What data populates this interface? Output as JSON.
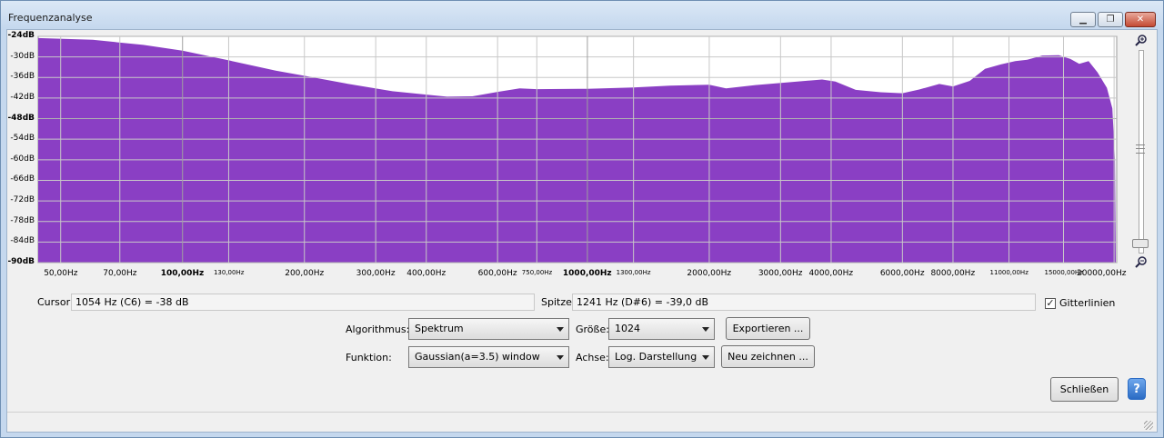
{
  "window": {
    "title": "Frequenzanalyse",
    "controls": {
      "minimize": "▁",
      "maximize": "❐",
      "close": "✕"
    }
  },
  "spectrum": {
    "fill_color": "#8a3fc4",
    "grid_color": "#c8c8c8",
    "db_labels": [
      {
        "text": "-24dB",
        "db": -24,
        "bold": true
      },
      {
        "text": "-30dB",
        "db": -30,
        "bold": false
      },
      {
        "text": "-36dB",
        "db": -36,
        "bold": false
      },
      {
        "text": "-42dB",
        "db": -42,
        "bold": false
      },
      {
        "text": "-48dB",
        "db": -48,
        "bold": true
      },
      {
        "text": "-54dB",
        "db": -54,
        "bold": false
      },
      {
        "text": "-60dB",
        "db": -60,
        "bold": false
      },
      {
        "text": "-66dB",
        "db": -66,
        "bold": false
      },
      {
        "text": "-72dB",
        "db": -72,
        "bold": false
      },
      {
        "text": "-78dB",
        "db": -78,
        "bold": false
      },
      {
        "text": "-84dB",
        "db": -84,
        "bold": false
      },
      {
        "text": "-90dB",
        "db": -90,
        "bold": true
      }
    ],
    "freq_labels": [
      {
        "text": "50,00Hz",
        "hz": 50,
        "size": "normal"
      },
      {
        "text": "70,00Hz",
        "hz": 70,
        "size": "normal"
      },
      {
        "text": "100,00Hz",
        "hz": 100,
        "size": "bold"
      },
      {
        "text": "130,00Hz",
        "hz": 130,
        "size": "small"
      },
      {
        "text": "200,00Hz",
        "hz": 200,
        "size": "normal"
      },
      {
        "text": "300,00Hz",
        "hz": 300,
        "size": "normal"
      },
      {
        "text": "400,00Hz",
        "hz": 400,
        "size": "normal"
      },
      {
        "text": "600,00Hz",
        "hz": 600,
        "size": "normal"
      },
      {
        "text": "750,00Hz",
        "hz": 750,
        "size": "small"
      },
      {
        "text": "1000,00Hz",
        "hz": 1000,
        "size": "bold"
      },
      {
        "text": "1300,00Hz",
        "hz": 1300,
        "size": "small"
      },
      {
        "text": "2000,00Hz",
        "hz": 2000,
        "size": "normal"
      },
      {
        "text": "3000,00Hz",
        "hz": 3000,
        "size": "normal"
      },
      {
        "text": "4000,00Hz",
        "hz": 4000,
        "size": "normal"
      },
      {
        "text": "6000,00Hz",
        "hz": 6000,
        "size": "normal"
      },
      {
        "text": "8000,00Hz",
        "hz": 8000,
        "size": "normal"
      },
      {
        "text": "11000,00Hz",
        "hz": 11000,
        "size": "small"
      },
      {
        "text": "15000,00Hz",
        "hz": 15000,
        "size": "small"
      },
      {
        "text": "20000,00Hz",
        "hz": 20000,
        "size": "normal"
      }
    ],
    "curve": [
      [
        44,
        -24.5
      ],
      [
        60,
        -25.0
      ],
      [
        80,
        -26.5
      ],
      [
        100,
        -28.2
      ],
      [
        130,
        -31.0
      ],
      [
        170,
        -34.0
      ],
      [
        200,
        -35.5
      ],
      [
        260,
        -38.0
      ],
      [
        330,
        -40.0
      ],
      [
        400,
        -41.0
      ],
      [
        450,
        -41.6
      ],
      [
        520,
        -41.5
      ],
      [
        600,
        -40.2
      ],
      [
        680,
        -39.2
      ],
      [
        750,
        -39.4
      ],
      [
        1000,
        -39.3
      ],
      [
        1300,
        -38.9
      ],
      [
        1600,
        -38.4
      ],
      [
        2000,
        -38.1
      ],
      [
        2200,
        -39.2
      ],
      [
        2600,
        -38.2
      ],
      [
        3200,
        -37.3
      ],
      [
        3800,
        -36.6
      ],
      [
        4100,
        -37.2
      ],
      [
        4600,
        -39.6
      ],
      [
        5300,
        -40.3
      ],
      [
        6000,
        -40.6
      ],
      [
        6600,
        -39.5
      ],
      [
        7400,
        -37.9
      ],
      [
        8000,
        -38.6
      ],
      [
        8800,
        -37.0
      ],
      [
        9600,
        -33.5
      ],
      [
        10500,
        -32.2
      ],
      [
        11400,
        -31.2
      ],
      [
        12200,
        -30.8
      ],
      [
        13300,
        -29.6
      ],
      [
        14600,
        -29.5
      ],
      [
        15600,
        -30.6
      ],
      [
        16400,
        -32.0
      ],
      [
        17300,
        -31.2
      ],
      [
        18200,
        -34.5
      ],
      [
        19200,
        -39.0
      ],
      [
        19800,
        -45.0
      ],
      [
        20100,
        -60.0
      ],
      [
        20200,
        -90.0
      ]
    ]
  },
  "scroll": {
    "zoom_in_icon": "🔍+",
    "zoom_out_icon": "🔍−"
  },
  "status": {
    "cursor_label": "Cursor:",
    "cursor_value": "1054 Hz (C6) = -38 dB",
    "peak_label": "Spitze:",
    "peak_value": "1241 Hz (D#6) = -39,0 dB",
    "gridlines_label": "Gitterlinien",
    "gridlines_checked": "✓"
  },
  "controls": {
    "algorithm_label": "Algorithmus:",
    "algorithm_value": "Spektrum",
    "size_label": "Größe:",
    "size_value": "1024",
    "export_button": "Exportieren ...",
    "function_label": "Funktion:",
    "function_value": "Gaussian(a=3.5) window",
    "axis_label": "Achse:",
    "axis_value": "Log. Darstellung",
    "redraw_button": "Neu zeichnen ...",
    "close_button": "Schließen",
    "help_icon": "?"
  }
}
